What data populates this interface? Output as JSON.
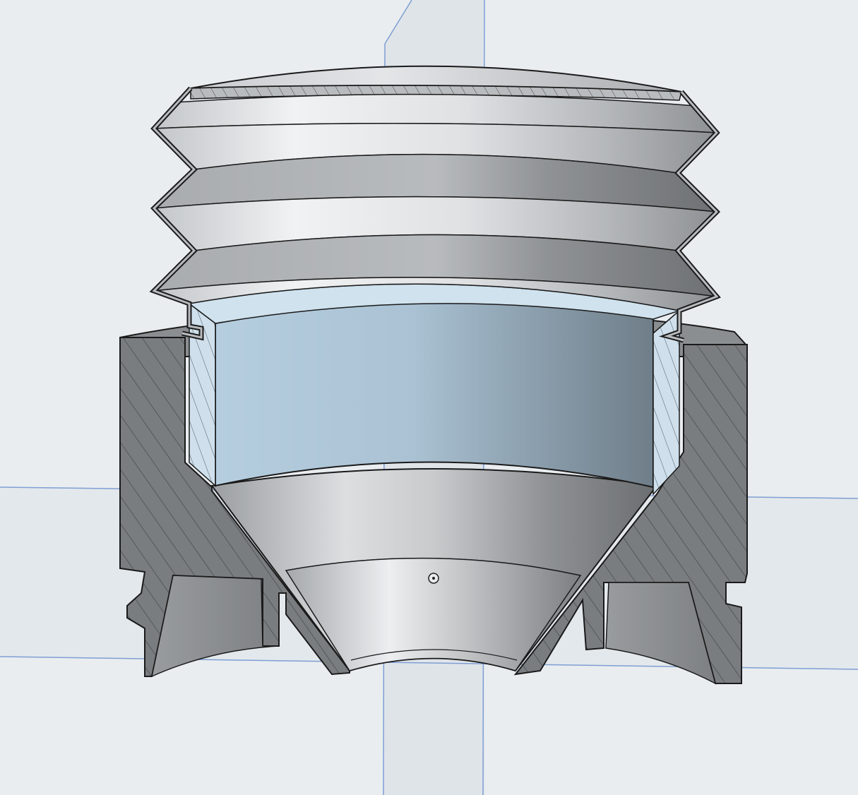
{
  "viewport": {
    "background": "#e9edf0",
    "plane_fill": "#dfe4e9",
    "plane_edge": "#7f9fd3"
  },
  "model": {
    "part": "bellows-cap-section-view",
    "section_hatch_fill": "#777a7d",
    "section_hatch_line": "#3c3f42",
    "bellows_shade_light": "#eef0f2",
    "bellows_shade_dark": "#8e9194",
    "sleeve_light": "#c4dbe9",
    "sleeve_dark": "#6f7e89",
    "cone_light": "#e8eaec",
    "cone_dark": "#707376",
    "edge_color": "#1a1a1a"
  },
  "icons": {
    "origin": "origin-point-icon"
  }
}
